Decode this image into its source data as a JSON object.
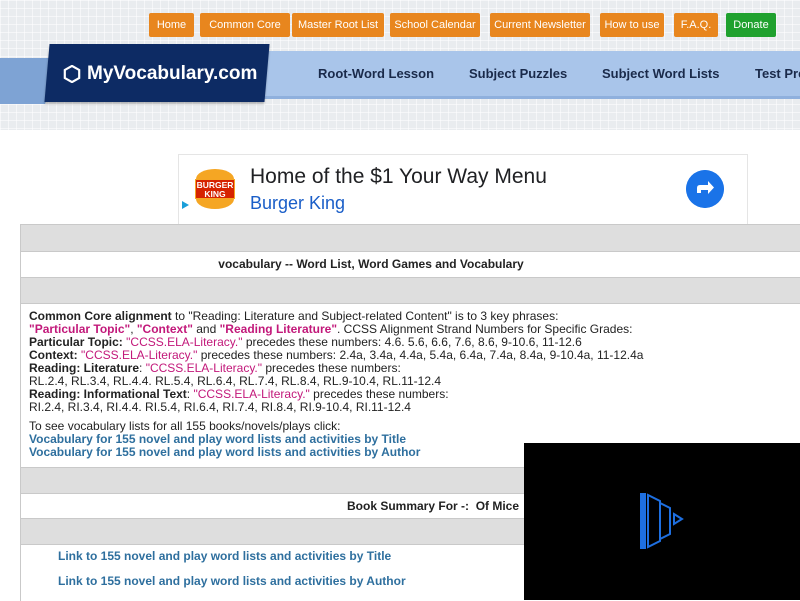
{
  "top_nav": [
    "Home",
    "Common Core",
    "Master Root List",
    "School Calendar",
    "Current Newsletter",
    "How to use",
    "F.A.Q.",
    "Donate"
  ],
  "logo": "MyVocabulary.com",
  "main_nav": [
    "Root-Word Lesson",
    "Subject Puzzles",
    "Subject Word Lists",
    "Test Pre"
  ],
  "ad": {
    "logo_top": "BURGER",
    "logo_bottom": "KING",
    "headline": "Home of the $1 Your Way Menu",
    "advertiser": "Burger King"
  },
  "page_title": "vocabulary -- Word List, Word Games and Vocabulary",
  "common_core": {
    "intro_label": "Common Core alignment",
    "intro_rest": " to \"Reading: Literature and Subject-related Content\" is to 3 key phrases:",
    "phrase1": "\"Particular Topic\"",
    "sep1": ", ",
    "phrase2": "\"Context\"",
    "sep2": " and ",
    "phrase3": "\"Reading Literature\"",
    "line2_rest": ". CCSS Alignment Strand Numbers for Specific Grades:",
    "pt_label": "Particular Topic:",
    "pt_code": "\"CCSS.ELA-Literacy.\"",
    "pt_rest": " precedes these numbers: 4.6. 5.6, 6.6, 7.6, 8.6, 9-10.6, 11-12.6",
    "ctx_label": "Context:",
    "ctx_code": "\"CCSS.ELA-Literacy.\"",
    "ctx_rest": " precedes these numbers: 2.4a, 3.4a, 4.4a, 5.4a, 6.4a, 7.4a, 8.4a, 9-10.4a, 11-12.4a",
    "rl_label": "Reading: Literature",
    "rl_code": "\"CCSS.ELA-Literacy.\"",
    "rl_rest": " precedes these numbers:",
    "rl_numbers": "RL.2.4, RL.3.4, RL.4.4. RL.5.4, RL.6.4, RL.7.4, RL.8.4, RL.9-10.4, RL.11-12.4",
    "ri_label": "Reading: Informational Text",
    "ri_code": "\"CCSS.ELA-Literacy.\"",
    "ri_rest": " precedes these numbers:",
    "ri_numbers": "RI.2.4, RI.3.4, RI.4.4. RI.5.4, RI.6.4, RI.7.4, RI.8.4, RI.9-10.4, RI.11-12.4"
  },
  "lists_intro": "To see vocabulary lists for all 155 books/novels/plays click:",
  "link_by_title": "Vocabulary for 155 novel and play word lists and activities by Title",
  "link_by_author": "Vocabulary for 155 novel and play word lists and activities by Author",
  "summary_label": "Book Summary For -:",
  "summary_book": "Of Mice",
  "lower_link_title": "Link to 155 novel and play word lists and activities by Title",
  "lower_link_author": "Link to 155 novel and play word lists and activities by Author"
}
